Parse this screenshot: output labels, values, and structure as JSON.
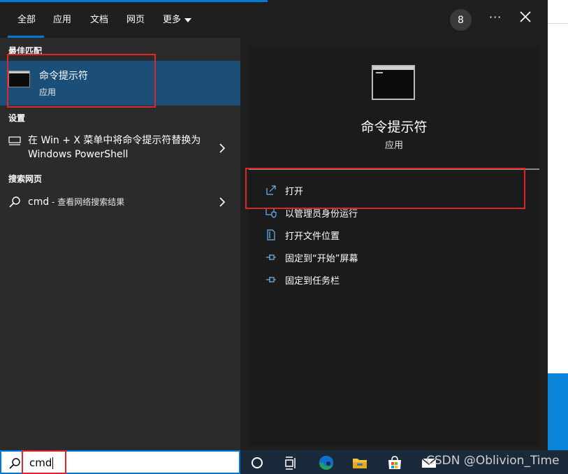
{
  "tabs": {
    "items": [
      {
        "label": "全部"
      },
      {
        "label": "应用"
      },
      {
        "label": "文档"
      },
      {
        "label": "网页"
      },
      {
        "label": "更多"
      }
    ],
    "badge_count": "8",
    "more_icon": "ellipsis-icon",
    "close_icon": "close-icon"
  },
  "left": {
    "best_match_header": "最佳匹配",
    "best_match": {
      "title": "命令提示符",
      "subtitle": "应用",
      "icon": "command-prompt-icon"
    },
    "settings_header": "设置",
    "setting_item": {
      "text": "在 Win + X 菜单中将命令提示符替换为 Windows PowerShell",
      "icon": "monitor-icon"
    },
    "web_header": "搜索网页",
    "web_item": {
      "query": "cmd",
      "suffix": " - 查看网络搜索结果",
      "icon": "search-icon"
    }
  },
  "right": {
    "app_title": "命令提示符",
    "app_type": "应用",
    "actions": [
      {
        "label": "打开",
        "icon": "open-icon"
      },
      {
        "label": "以管理员身份运行",
        "icon": "shield-icon"
      },
      {
        "label": "打开文件位置",
        "icon": "file-location-icon"
      },
      {
        "label": "固定到“开始”屏幕",
        "icon": "pin-icon"
      },
      {
        "label": "固定到任务栏",
        "icon": "pin-icon"
      }
    ]
  },
  "search": {
    "value": "cmd",
    "icon": "search-icon"
  },
  "taskbar": {
    "icons": [
      "cortana-icon",
      "task-view-icon",
      "edge-icon",
      "file-explorer-icon",
      "store-icon",
      "mail-icon"
    ]
  },
  "watermark": "CSDN @Oblivion_Time",
  "colors": {
    "accent": "#0078d7",
    "highlight": "#1c4f78",
    "annotation_red": "#e0262b",
    "panel": "#1f1f1f"
  }
}
